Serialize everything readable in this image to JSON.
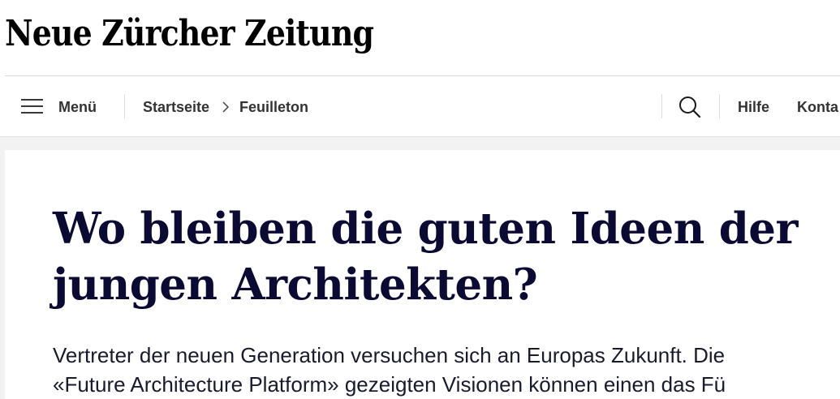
{
  "masthead": {
    "logo_text": "Neue Zürcher Zeitung"
  },
  "nav": {
    "menu_icon": "hamburger-menu-icon",
    "menu_label": "Menü",
    "breadcrumb": {
      "home": "Startseite",
      "separator_icon": "chevron-right-icon",
      "section": "Feuilleton"
    },
    "search_icon": "search-icon",
    "help_label": "Hilfe",
    "contact_label": "Konta"
  },
  "article": {
    "headline_line1": "Wo bleiben die guten Ideen der",
    "headline_line2": "jungen Architekten?",
    "lead_line1": "Vertreter der neuen Generation versuchen sich an Europas Zukunft. Die",
    "lead_line2": "«Future Architecture Platform» gezeigten Visionen können einen das Fü"
  },
  "colors": {
    "headline": "#0b0a33",
    "nav_text": "#333333",
    "page_background": "#f2f2f2"
  }
}
